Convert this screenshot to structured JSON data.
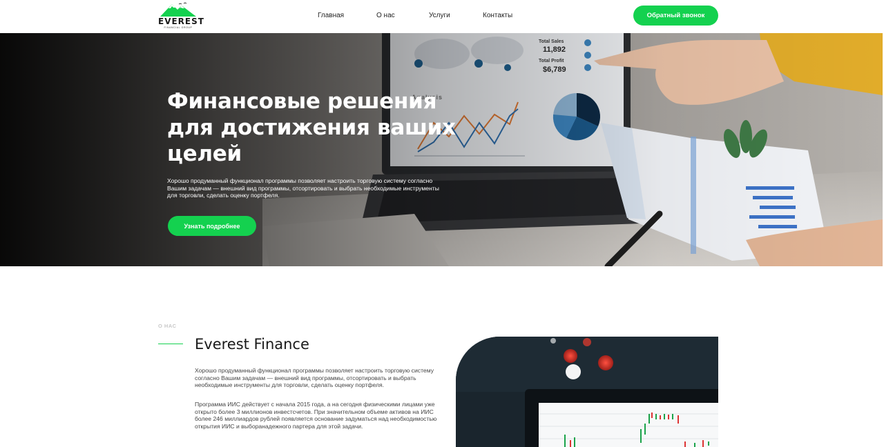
{
  "header": {
    "logo_text": "EVEREST",
    "logo_subtext": "FINANCIAL GROUP",
    "nav": [
      "Главная",
      "О нас",
      "Услуги",
      "Контакты"
    ],
    "cta_label": "Обратный звонок"
  },
  "hero": {
    "title": "Финансовые решения для достижения ваших целей",
    "text": "Хорошо продуманный функционал программы позволяет настроить торговую систему согласно Вашим задачам — внешний вид программы, отсортировать и выбрать необходимые инструменты для торговли, сделать оценку портфеля.",
    "button_label": "Узнать подробнее",
    "screen": {
      "total_sales_label": "Total Sales",
      "total_sales_value": "11,892",
      "total_profit_label": "Total Profit",
      "total_profit_value": "$6,789",
      "analysis_label": "Analysis"
    }
  },
  "about": {
    "eyebrow": "О НАС",
    "title": "Everest Finance",
    "paragraph_1": "Хорошо продуманный функционал программы позволяет настроить торговую систему согласно Вашим задачам — внешний вид программы, отсортировать и выбрать необходимые инструменты для торговли, сделать оценку портфеля.",
    "paragraph_2": "Программа ИИС действует с начала 2015 года, а на сегодня физическими лицами уже открыто более 3 миллионов инвестсчетов. При значительном объеме активов на ИИС более 246 миллиардов рублей появляется основание задуматься над необходимостью открытия ИИС и выборанадежного партера для этой задачи."
  },
  "colors": {
    "accent": "#14d14f",
    "hero_overlay": "#111111",
    "eyebrow": "#c8c8c8"
  }
}
